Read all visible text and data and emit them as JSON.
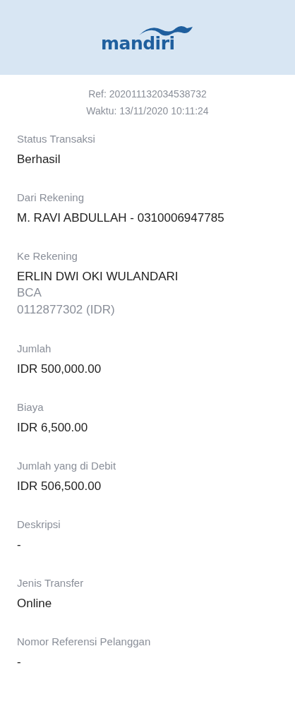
{
  "header": {
    "logo_text": "mandiri"
  },
  "meta": {
    "ref": "Ref: 202011132034538732",
    "time": "Waktu: 13/11/2020 10:11:24"
  },
  "fields": [
    {
      "label": "Status Transaksi",
      "value": "Berhasil"
    },
    {
      "label": "Dari Rekening",
      "value": "M. RAVI ABDULLAH - 0310006947785"
    },
    {
      "label": "Ke Rekening",
      "value": "ERLIN DWI OKI WULANDARI",
      "details": [
        "BCA",
        "0112877302 (IDR)"
      ]
    },
    {
      "label": "Jumlah",
      "value": "IDR 500,000.00"
    },
    {
      "label": "Biaya",
      "value": "IDR 6,500.00"
    },
    {
      "label": "Jumlah yang di Debit",
      "value": "IDR 506,500.00"
    },
    {
      "label": "Deskripsi",
      "value": "-"
    },
    {
      "label": "Jenis Transfer",
      "value": "Online"
    },
    {
      "label": "Nomor Referensi Pelanggan",
      "value": "-"
    }
  ]
}
